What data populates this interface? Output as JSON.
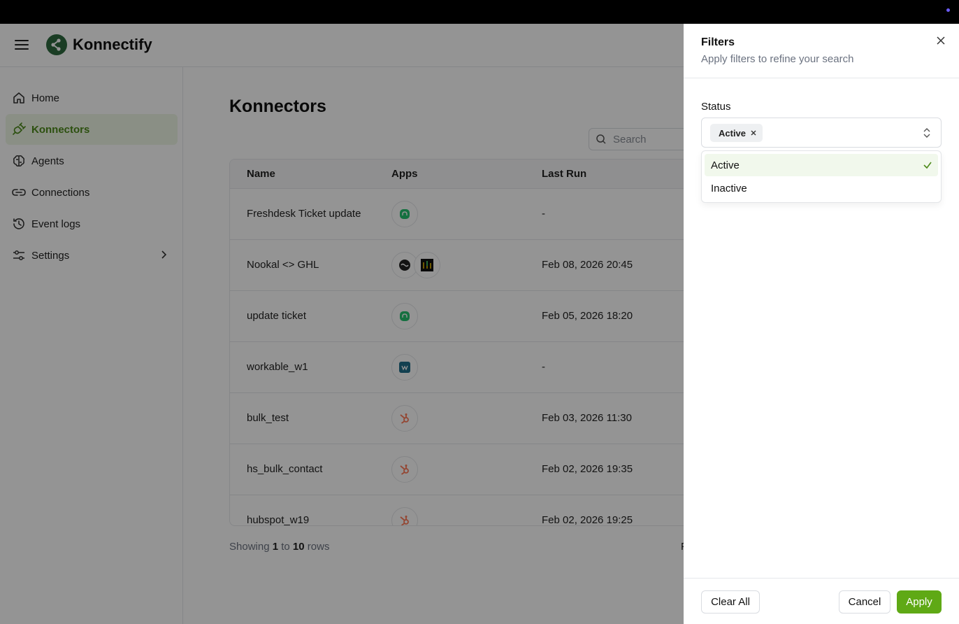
{
  "app": {
    "brand": "Konnectify"
  },
  "sidebar": {
    "items": [
      {
        "label": "Home",
        "icon": "home-icon"
      },
      {
        "label": "Konnectors",
        "icon": "plug-icon",
        "active": true
      },
      {
        "label": "Agents",
        "icon": "brain-icon"
      },
      {
        "label": "Connections",
        "icon": "link-icon"
      },
      {
        "label": "Event logs",
        "icon": "history-icon"
      },
      {
        "label": "Settings",
        "icon": "sliders-icon"
      }
    ]
  },
  "main": {
    "title": "Konnectors",
    "search_placeholder": "Search",
    "table": {
      "columns": [
        "Name",
        "Apps",
        "Last Run"
      ],
      "rows": [
        {
          "name": "Freshdesk Ticket update",
          "apps": [
            "freshdesk"
          ],
          "last_run": "-"
        },
        {
          "name": "Nookal <> GHL",
          "apps": [
            "nookal",
            "ghl"
          ],
          "last_run": "Feb 08, 2026 20:45"
        },
        {
          "name": "update ticket",
          "apps": [
            "freshdesk"
          ],
          "last_run": "Feb 05, 2026 18:20"
        },
        {
          "name": "workable_w1",
          "apps": [
            "workable"
          ],
          "last_run": "-"
        },
        {
          "name": "bulk_test",
          "apps": [
            "hubspot"
          ],
          "last_run": "Feb 03, 2026 11:30"
        },
        {
          "name": "hs_bulk_contact",
          "apps": [
            "hubspot"
          ],
          "last_run": "Feb 02, 2026 19:35"
        },
        {
          "name": "hubspot_w19",
          "apps": [
            "hubspot"
          ],
          "last_run": "Feb 02, 2026 19:25"
        }
      ]
    },
    "footer": {
      "prefix": "Showing",
      "from": "1",
      "to_word": "to",
      "to": "10",
      "suffix": "rows",
      "right_partial": "P"
    }
  },
  "filters": {
    "title": "Filters",
    "subtitle": "Apply filters to refine your search",
    "status_label": "Status",
    "selected_chip": "Active",
    "options": [
      {
        "label": "Active",
        "selected": true
      },
      {
        "label": "Inactive",
        "selected": false
      }
    ],
    "clear_label": "Clear All",
    "cancel_label": "Cancel",
    "apply_label": "Apply"
  },
  "colors": {
    "accent": "#5fa915",
    "active_nav_bg": "#eef6e6",
    "hubspot": "#ff7a59",
    "freshdesk": "#25c16f"
  }
}
